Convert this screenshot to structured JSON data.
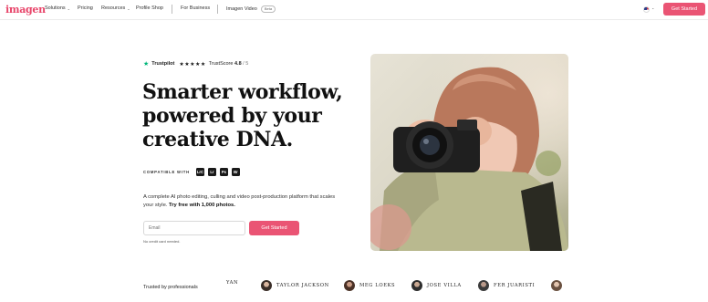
{
  "nav": {
    "logo": "imagen",
    "items": [
      {
        "label": "Solutions",
        "has_chevron": true
      },
      {
        "label": "Pricing",
        "has_chevron": false
      },
      {
        "label": "Resources",
        "has_chevron": true
      },
      {
        "label": "Profile Shop",
        "has_chevron": false
      },
      {
        "label": "For Business",
        "has_chevron": false
      },
      {
        "label": "Imagen Video",
        "badge": "Beta"
      }
    ],
    "language_icon": "us-flag-icon",
    "cta_label": "Get Started"
  },
  "hero": {
    "trustpilot": {
      "brand": "Trustpilot",
      "stars": "★★★★★",
      "score_prefix": "TrustScore",
      "score": "4.8",
      "score_suffix": "/ 5"
    },
    "headline": [
      "Smarter workflow,",
      "powered by your",
      "creative DNA."
    ],
    "compatible_label": "COMPATIBLE WITH",
    "apps": [
      "LrC",
      "Lr",
      "Ps",
      "Br"
    ],
    "description": "A complete AI photo editing, culling and video post-production platform that scales your style.",
    "description_bold": "Try free with 1,000 photos.",
    "email_placeholder": "Email",
    "cta_label": "Get Started",
    "no_card": "No credit card needed."
  },
  "trusted": {
    "label": "Trusted by professionals",
    "professionals": [
      {
        "name": "YAN"
      },
      {
        "name": "TAYLOR JACKSON"
      },
      {
        "name": "MEG LOEKS"
      },
      {
        "name": "JOSE VILLA"
      },
      {
        "name": "FER JUARISTI"
      },
      {
        "name": ""
      }
    ]
  },
  "colors": {
    "brand": "#e8456a",
    "cta": "#ea5474",
    "trustpilot": "#00b67a"
  }
}
